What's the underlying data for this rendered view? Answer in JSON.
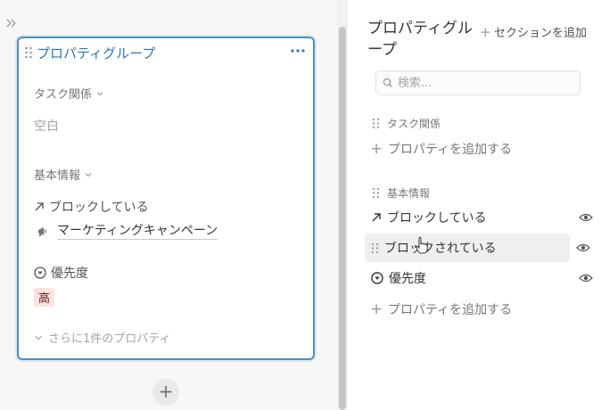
{
  "card": {
    "title": "プロパティグループ",
    "section_task": "タスク関係",
    "empty_label": "空白",
    "section_basic": "基本情報",
    "blocking_label": "ブロックしている",
    "relation_item": "マーケティングキャンペーン",
    "priority_label": "優先度",
    "priority_tag": "高",
    "more_props": "さらに1件のプロパティ",
    "add_button": "+"
  },
  "panel": {
    "title": "プロパティグループ",
    "add_section": "セクションを追加",
    "search_placeholder": "検索...",
    "group1": "タスク関係",
    "add_property_1": "プロパティを追加する",
    "group2": "基本情報",
    "props": [
      {
        "label": "ブロックしている",
        "icon": "arrow-up-right-icon"
      },
      {
        "label": "ブロックされている",
        "icon": "drag-handle-icon"
      },
      {
        "label": "優先度",
        "icon": "status-icon"
      }
    ],
    "add_property_2": "プロパティを追加する"
  },
  "colors": {
    "accent": "#2e75b6",
    "tag_bg": "#fbe3e0",
    "hover_bg": "#efefed"
  }
}
